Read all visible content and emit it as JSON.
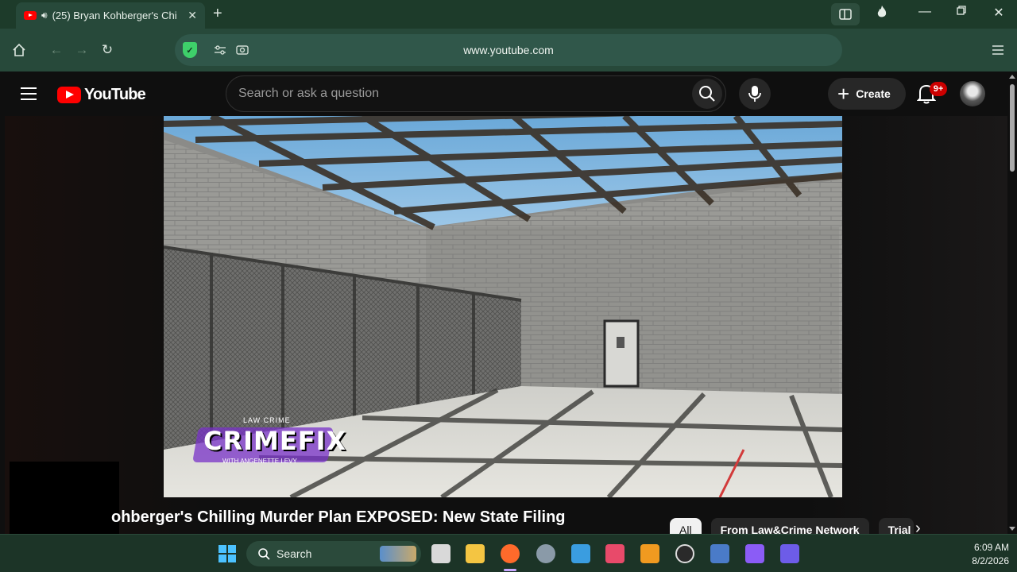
{
  "browser": {
    "tab_title": "(25) Bryan Kohberger's Chi",
    "url": "www.youtube.com"
  },
  "youtube": {
    "logo_text": "YouTube",
    "search_placeholder": "Search or ask a question",
    "create_label": "Create",
    "notification_badge": "9+"
  },
  "video": {
    "watermark_top": "LAW CRIME",
    "watermark_main": "CRIMEFIX",
    "watermark_sub": "WITH ANGENETTE LEVY",
    "title": "ohberger's Chilling Murder Plan EXPOSED: New State Filing"
  },
  "chips": [
    "All",
    "From Law&Crime Network",
    "Trial"
  ],
  "taskbar": {
    "search_label": "Search",
    "time": "6:09 AM",
    "date": "8/2/2026"
  }
}
